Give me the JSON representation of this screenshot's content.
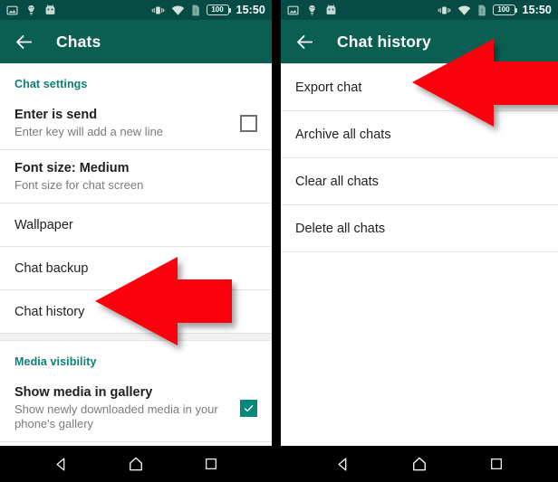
{
  "status_bar": {
    "icons_left": [
      "image-icon",
      "flashlight-icon",
      "android-head-icon"
    ],
    "icons_right": [
      "vibrate-icon",
      "wifi-icon",
      "sim-card-icon"
    ],
    "battery_level": "100",
    "time": "15:50"
  },
  "colors": {
    "status_bar": "#064c44",
    "toolbar": "#0a5f52",
    "section_header": "#0c8074",
    "checkbox_checked": "#03887b",
    "arrow": "#fb0007",
    "navbar": "#000000",
    "divider": "#e4e4e4",
    "band": "#f2f2f2"
  },
  "left_panel": {
    "toolbar": {
      "back_icon": "arrow-left-icon",
      "title": "Chats"
    },
    "sections": [
      {
        "header": "Chat settings",
        "rows": [
          {
            "title": "Enter is send",
            "subtitle": "Enter key will add a new line",
            "control": "checkbox",
            "checked": false
          },
          {
            "title": "Font size: Medium",
            "subtitle": "Font size for chat screen",
            "control": "none"
          },
          {
            "title": "Wallpaper",
            "subtitle": "",
            "control": "none"
          },
          {
            "title": "Chat backup",
            "subtitle": "",
            "control": "none"
          },
          {
            "title": "Chat history",
            "subtitle": "",
            "control": "none"
          }
        ]
      },
      {
        "header": "Media visibility",
        "rows": [
          {
            "title": "Show media in gallery",
            "subtitle": "Show newly downloaded media in your phone's gallery",
            "control": "checkbox",
            "checked": true
          }
        ]
      }
    ]
  },
  "right_panel": {
    "toolbar": {
      "back_icon": "arrow-left-icon",
      "title": "Chat history"
    },
    "rows": [
      {
        "title": "Export chat"
      },
      {
        "title": "Archive all chats"
      },
      {
        "title": "Clear all chats"
      },
      {
        "title": "Delete all chats"
      }
    ]
  },
  "navbar": {
    "buttons": [
      "back-nav-icon",
      "home-nav-icon",
      "recents-nav-icon"
    ]
  },
  "annotations": [
    {
      "name": "arrow-chat-history",
      "points_to": "Chat history",
      "direction": "left"
    },
    {
      "name": "arrow-export-chat",
      "points_to": "Export chat",
      "direction": "left"
    }
  ]
}
